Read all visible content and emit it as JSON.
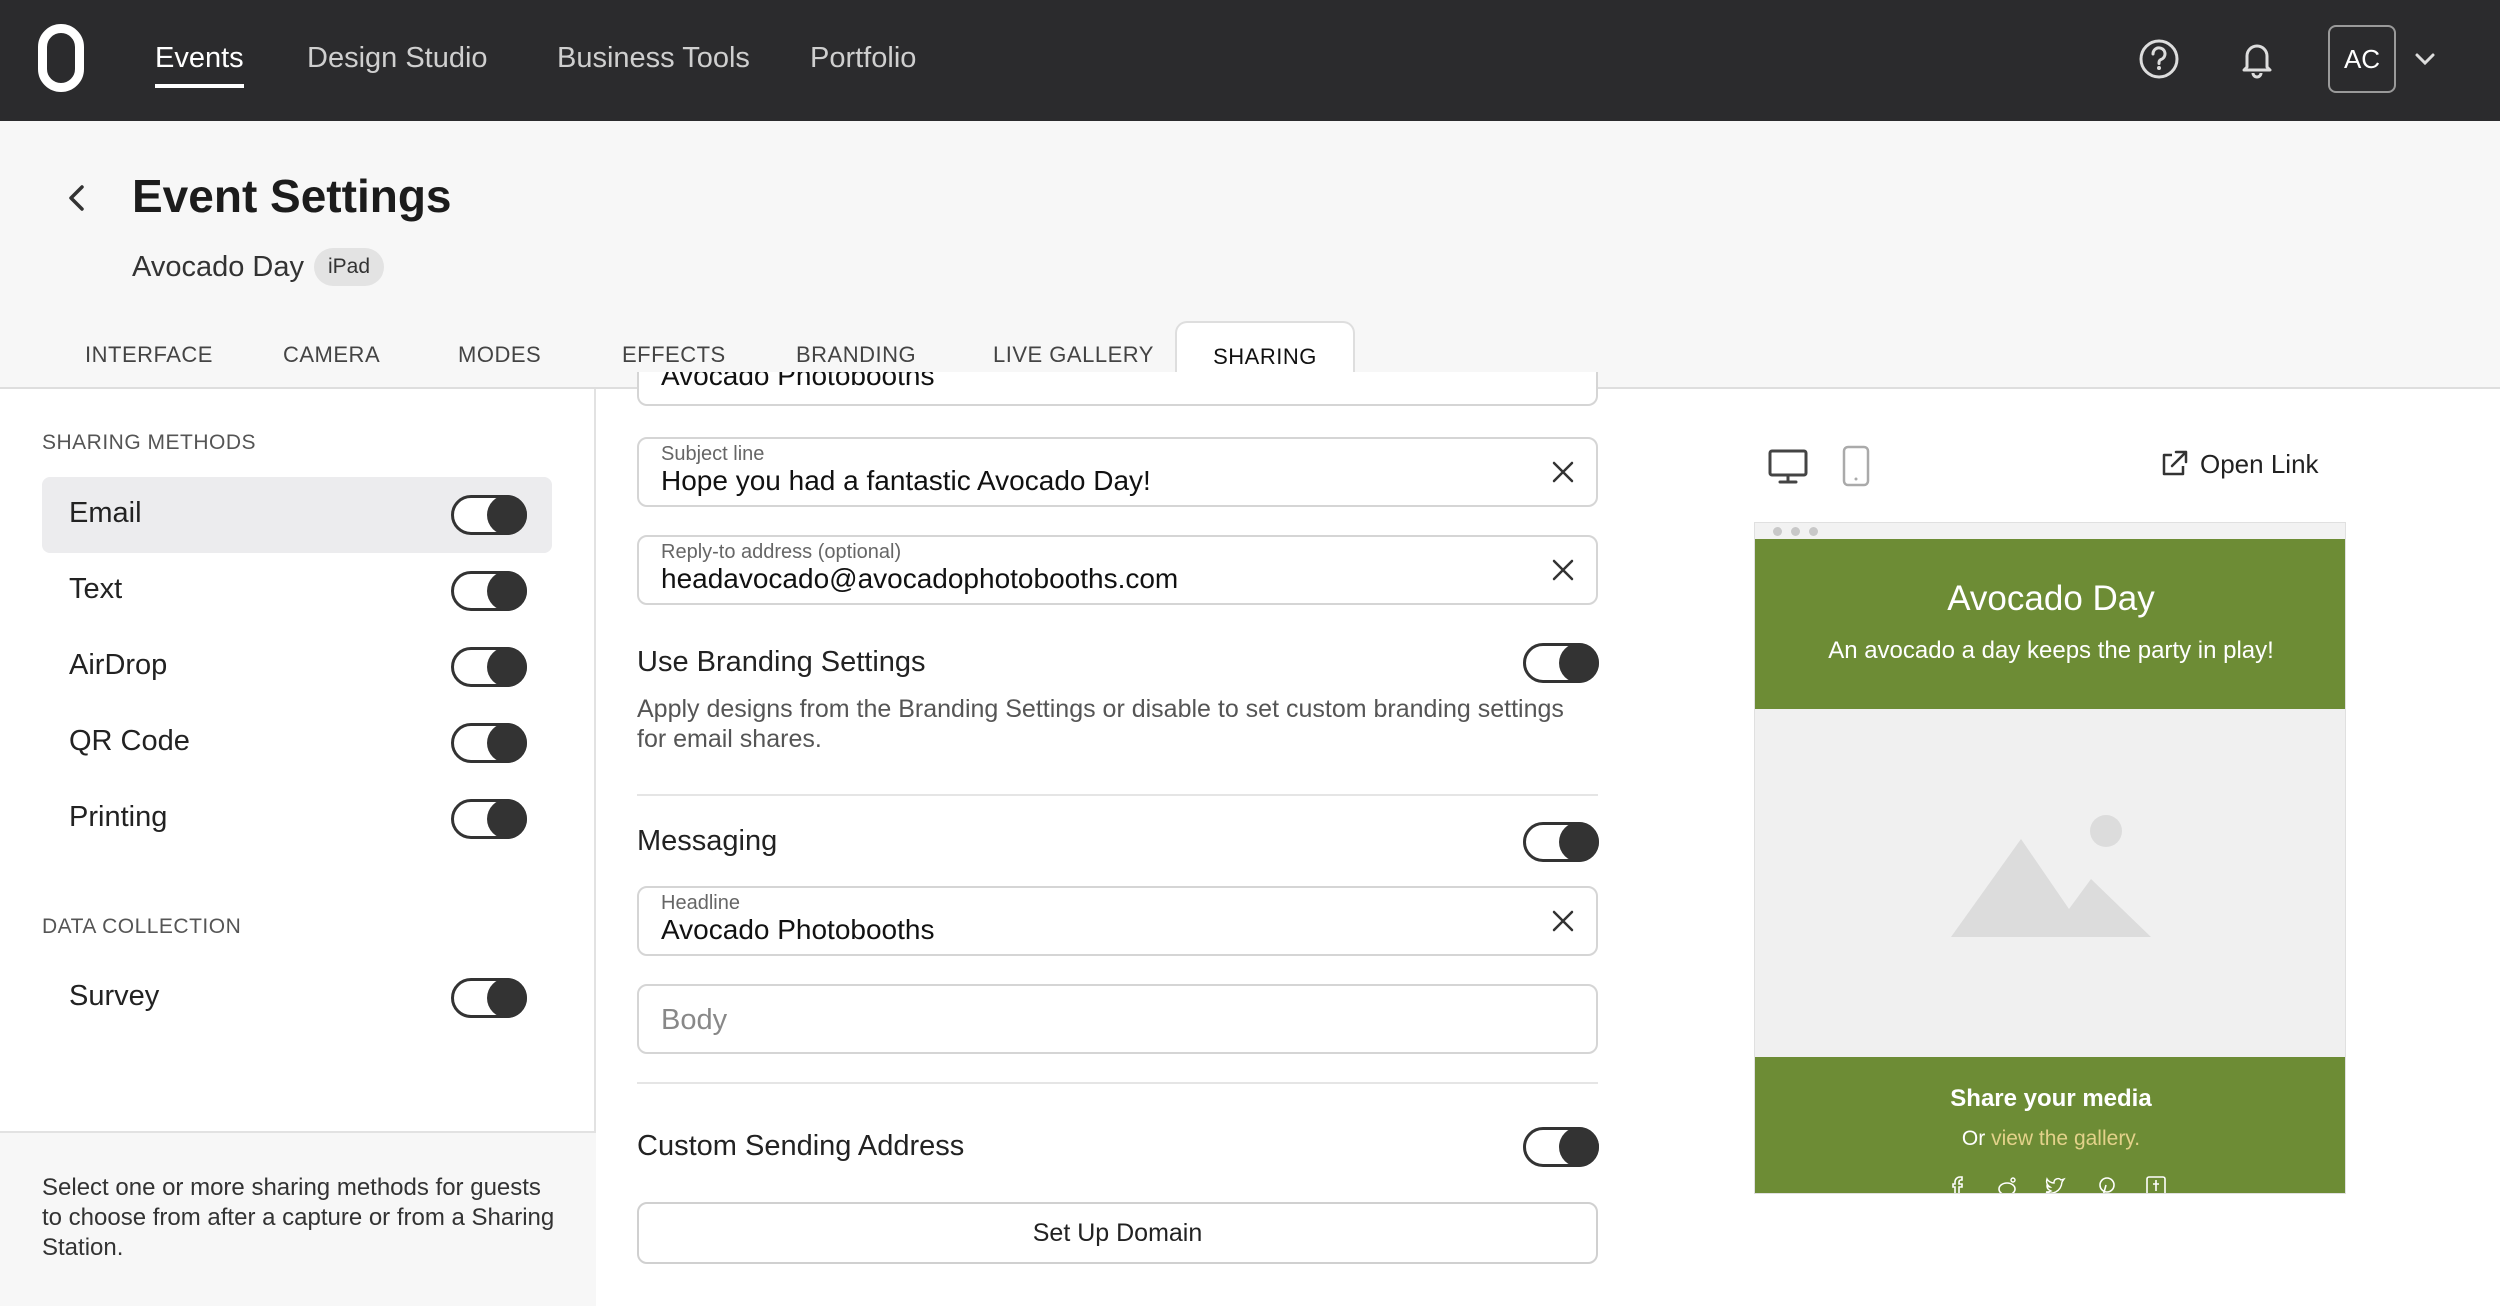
{
  "colors": {
    "topbar_bg": "#2b2b2d",
    "brand_green": "#6d8c35",
    "link_gold": "#e3d28a"
  },
  "nav": {
    "logo": "o-logo-icon",
    "items": [
      {
        "label": "Events",
        "active": true
      },
      {
        "label": "Design Studio",
        "active": false
      },
      {
        "label": "Business Tools",
        "active": false
      },
      {
        "label": "Portfolio",
        "active": false
      }
    ],
    "help_icon": "question-circle-icon",
    "bell_icon": "bell-icon",
    "avatar_initials": "AC"
  },
  "header": {
    "title": "Event Settings",
    "event_name": "Avocado Day",
    "device_badge": "iPad",
    "tabs": [
      {
        "label": "INTERFACE",
        "active": false
      },
      {
        "label": "CAMERA",
        "active": false
      },
      {
        "label": "MODES",
        "active": false
      },
      {
        "label": "EFFECTS",
        "active": false
      },
      {
        "label": "BRANDING",
        "active": false
      },
      {
        "label": "LIVE GALLERY",
        "active": false
      },
      {
        "label": "SHARING",
        "active": true
      }
    ]
  },
  "sidebar": {
    "sharing_methods_label": "SHARING METHODS",
    "methods": [
      {
        "label": "Email",
        "enabled": true,
        "selected": true
      },
      {
        "label": "Text",
        "enabled": true,
        "selected": false
      },
      {
        "label": "AirDrop",
        "enabled": true,
        "selected": false
      },
      {
        "label": "QR Code",
        "enabled": true,
        "selected": false
      },
      {
        "label": "Printing",
        "enabled": true,
        "selected": false
      }
    ],
    "data_collection_label": "DATA COLLECTION",
    "data_items": [
      {
        "label": "Survey",
        "enabled": true
      }
    ],
    "help_text": "Select one or more sharing methods for guests to choose from after a capture or from a Sharing Station."
  },
  "form": {
    "from_name_value": "Avocado Photobooths",
    "subject": {
      "label": "Subject line",
      "value": "Hope you had a fantastic Avocado Day!"
    },
    "reply_to": {
      "label": "Reply-to address (optional)",
      "value": "headavocado@avocadophotobooths.com"
    },
    "branding": {
      "title": "Use Branding Settings",
      "enabled": true,
      "description": "Apply designs from the Branding Settings or disable to set custom branding settings for email shares."
    },
    "messaging": {
      "title": "Messaging",
      "enabled": true
    },
    "headline": {
      "label": "Headline",
      "value": "Avocado Photobooths"
    },
    "body": {
      "placeholder": "Body",
      "value": ""
    },
    "custom_sending": {
      "title": "Custom Sending Address",
      "enabled": true
    },
    "setup_domain_button": "Set Up Domain"
  },
  "preview": {
    "desktop_icon": "desktop-icon",
    "mobile_icon": "mobile-icon",
    "open_link": "Open Link",
    "title": "Avocado Day",
    "subtitle": "An avocado a day keeps the party in play!",
    "image_icon": "image-placeholder-icon",
    "share_heading": "Share your media",
    "share_or": "Or",
    "share_link": "view the gallery.",
    "social_icons": [
      "facebook-icon",
      "reddit-icon",
      "twitter-icon",
      "pinterest-icon",
      "tumblr-icon"
    ]
  }
}
